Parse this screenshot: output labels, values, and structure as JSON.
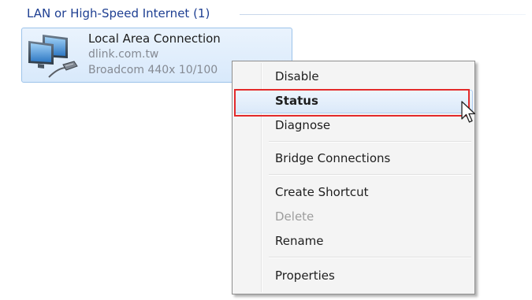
{
  "group": {
    "title": "LAN or High-Speed Internet (1)"
  },
  "connection": {
    "name": "Local Area Connection",
    "domain": "dlink.com.tw",
    "device": "Broadcom 440x 10/100",
    "icon": "network-adapter-icon"
  },
  "context_menu": {
    "items": [
      {
        "label": "Disable",
        "enabled": true,
        "default": false
      },
      {
        "label": "Status",
        "enabled": true,
        "default": true,
        "highlighted": true
      },
      {
        "label": "Diagnose",
        "enabled": true,
        "default": false
      },
      {
        "label": "Bridge Connections",
        "enabled": true,
        "default": false
      },
      {
        "label": "Create Shortcut",
        "enabled": true,
        "default": false
      },
      {
        "label": "Delete",
        "enabled": false,
        "default": false
      },
      {
        "label": "Rename",
        "enabled": true,
        "default": false
      },
      {
        "label": "Properties",
        "enabled": true,
        "default": false
      }
    ]
  },
  "colors": {
    "group_header": "#1e3f92",
    "annotation_box": "#e32a2a",
    "disabled_text": "#9d9d9d"
  },
  "cursor": {
    "icon": "mouse-pointer-icon"
  }
}
